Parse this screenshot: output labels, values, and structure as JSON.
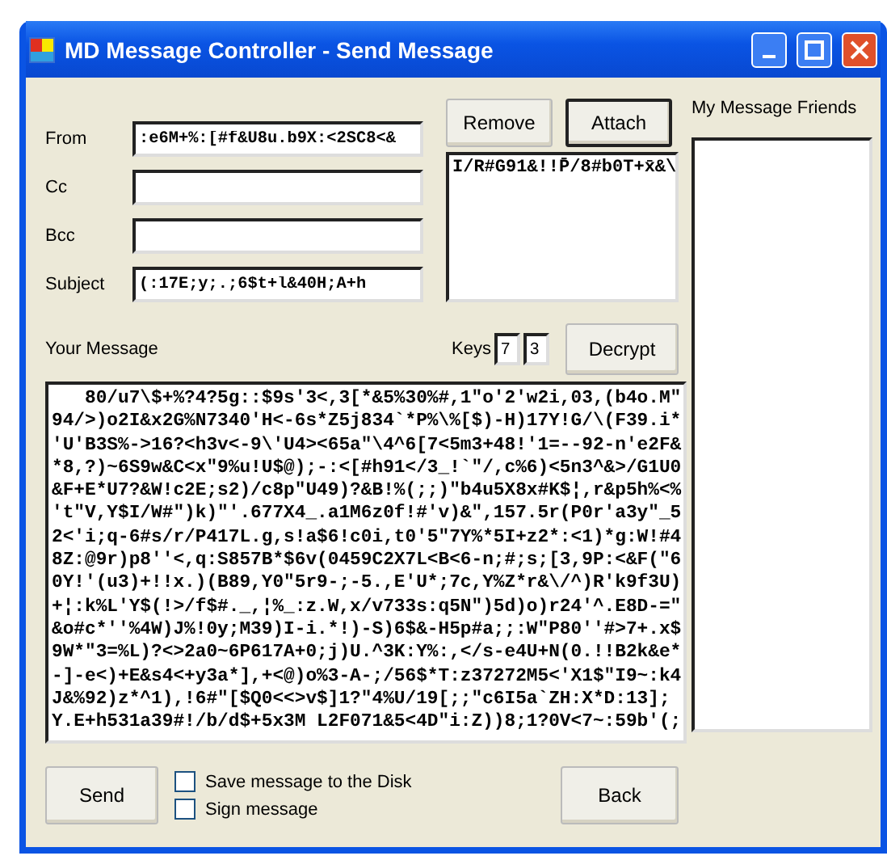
{
  "window": {
    "title": "MD Message Controller - Send Message"
  },
  "fields": [
    {
      "label": "From",
      "value": ":e6M+%:[#f&U8u.b9X:<2SC8<&"
    },
    {
      "label": "Cc"
    },
    {
      "label": "Bcc"
    },
    {
      "label": "Subject",
      "value": "(:17E;y;.;6$t+l&40H;A+h"
    }
  ],
  "attachments": {
    "buttons": [
      {
        "label": "Remove",
        "focused": false
      },
      {
        "label": "Attach",
        "focused": true
      }
    ],
    "items": [
      "I/R#G91&!!P̄/8#b0T+x̄&\\"
    ]
  },
  "message": {
    "label": "Your Message",
    "keys_label": "Keys",
    "keys": [
      "7",
      "3"
    ],
    "decrypt_button": "Decrypt",
    "lines": [
      "   80/u7\\$+%?4?5g::$9s'3<,3[*&5%30%#,1\"o'2'w2i,03,(b4o.M\"",
      "94/>)o2I&x2G%N7340'H<-6s*Z5j834`*P%\\%[$)-H)17Y!G/\\(F39.i*",
      "'U'B3S%->16?<h3v<-9\\'U4><65a\"\\4^6[7<5m3+48!'1=--92-n'e2F&",
      "*8,?)~6S9w&C<x\"9%u!U$@);-:<[#h91</3_!`\"/,c%6)<5n3^&>/G1U0",
      "&F+E*U7?&W!c2E;s2)/c8p\"U49)?&B!%(;;)\"b4u5X8x#K$¦,r&p5h%<%",
      "'t\"V,Y$I/W#\")k)\"'.677X4_.a1M6z0f!#'v)&\",157.5r(P0r'a3y\"_5",
      "2<'i;q-6#s/r/P417L.g,s!a$6!c0i,t0'5\"7Y%*5I+z2*:<1)*g:W!#4",
      "8Z:@9r)p8''<,q:S857B*$6v(0459C2X7L<B<6-n;#;s;[3,9P:<&F(\"6",
      "0Y!'(u3)+!!x.)(B89,Y0\"5r9-;-5.,E'U*;7c,Y%Z*r&\\/^)R'k9f3U)",
      "+¦:k%L'Y$(!>/f$#._,¦%_:z.W,x/v733s:q5N\")5d)o)r24'^.E8D-=\"",
      "&o#c*''%4W)J%!0y;M39)I-i.*!)-S)6$&-H5p#a;;:W\"P80''#>7+.x$",
      "9W*\"3=%L)?<>2a0~6P617A+0;j)U.^3K:Y%:,</s-e4U+N(0.!!B2k&e*",
      "-]-e<)+E&s4<+y3a*],+<@)o%3-A-;/56$*T:z37272M5<'X1$\"I9~:k4",
      "J&%92)z*^1),!6#\"[$Q0<<>v$]1?\"4%U/19[;;\"c6I5a`ZH:X*D:13];",
      "Y.E+h531a39#!/b/d$+5x3M L2F071&5<4D\"i:Z))8;1?0V<7~:59b'(;"
    ]
  },
  "friends": {
    "label": "My Message Friends"
  },
  "footer": {
    "send_button": "Send",
    "options": [
      {
        "label": "Save message to the Disk",
        "checked": false
      },
      {
        "label": "Sign message",
        "checked": false
      }
    ],
    "back_button": "Back"
  }
}
